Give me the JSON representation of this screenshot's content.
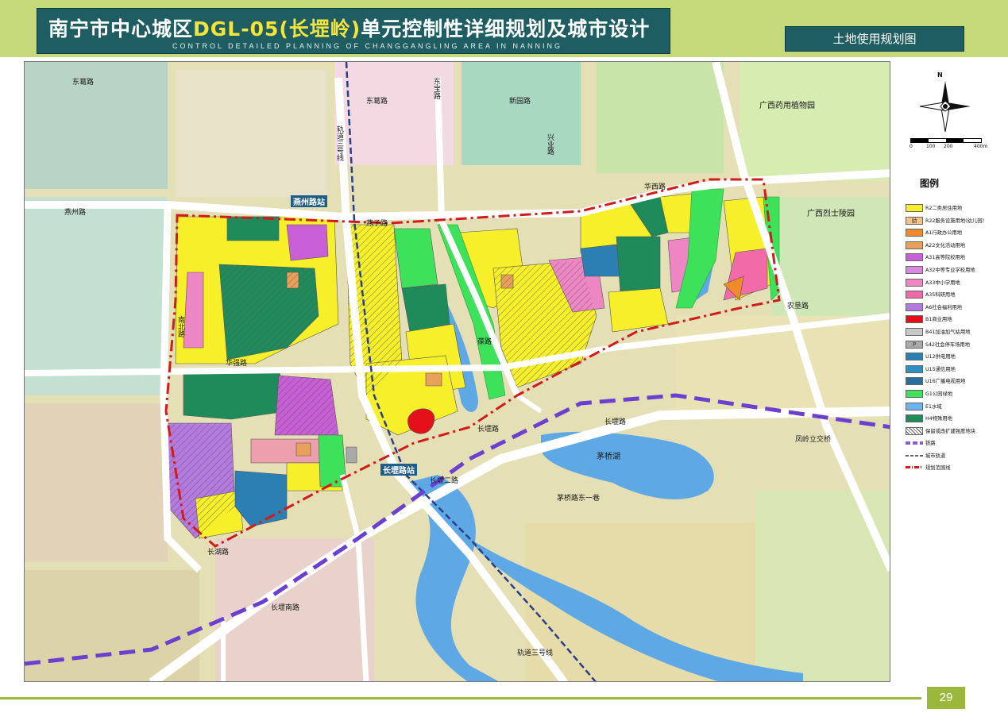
{
  "header": {
    "title_prefix": "南宁市中心城区",
    "title_code": "DGL-05(长堽岭)",
    "title_suffix": "单元控制性详细规划及城市设计",
    "subtitle": "CONTROL DETAILED PLANNING OF CHANGGANGLING AREA IN NANNING",
    "sheet_title": "土地使用规划图"
  },
  "map": {
    "labels": {
      "dongge_rd_1": "东葛路",
      "dongge_rd_2": "东葛路",
      "yanzi_rd": "燕子路",
      "huaxi_rd": "华西路",
      "xinyuan_rd": "新园路",
      "dongbao_rd": "东宝路",
      "xingye_rd": "兴业路",
      "bao_rd": "葆路",
      "ginjiang_rd": "华强路",
      "gangbei_rd": "南北路",
      "yanzhou_rd": "燕州路",
      "changgang_rd": "长堽路",
      "changgang_rd2": "长堽路",
      "rail_line_3": "轨道三号线",
      "rail_line_3b": "轨道三号线",
      "bottom_rd": "长堽二路",
      "bottom_rd2": "长堽南路",
      "changqiao_rd": "长湖路",
      "herb_garden": "广西药用植物园",
      "martyrs_cemetery": "广西烈士陵园",
      "maoqiao_lake": "茅桥湖",
      "maoqiao_rd": "茅桥路东一巷",
      "lingjiang": "凤岭立交桥",
      "nongken_rd": "农垦路",
      "yanzhou_station": "燕州路站",
      "changgang_station": "长堽路站"
    }
  },
  "legend": {
    "north": "N",
    "scale": [
      "0",
      "100",
      "200",
      "400m"
    ],
    "title": "图例",
    "items": [
      {
        "code": "R2",
        "label": "R2二类居住用地",
        "color": "#f7ef2a",
        "mark": ""
      },
      {
        "code": "R22",
        "label": "R22服务设施用地(幼儿园)",
        "color": "#f4c28a",
        "mark": "幼"
      },
      {
        "code": "A1",
        "label": "A1行政办公用地",
        "color": "#f08a2a",
        "mark": ""
      },
      {
        "code": "A22",
        "label": "A22文化活动用地",
        "color": "#e8a05a",
        "mark": ""
      },
      {
        "code": "A31",
        "label": "A31高等院校用地",
        "color": "#c95fd6",
        "mark": ""
      },
      {
        "code": "A32",
        "label": "A32中等专业学校用地",
        "color": "#d98ae0",
        "mark": ""
      },
      {
        "code": "A33",
        "label": "A33中小学用地",
        "color": "#ee86c4",
        "mark": ""
      },
      {
        "code": "A35",
        "label": "A35科研用地",
        "color": "#f26aa8",
        "mark": ""
      },
      {
        "code": "A6",
        "label": "A6社会福利用地",
        "color": "#b57ae0",
        "mark": ""
      },
      {
        "code": "B1",
        "label": "B1商业用地",
        "color": "#e3101a",
        "mark": ""
      },
      {
        "code": "B41",
        "label": "B41加油加气站用地",
        "color": "#c9c9c9",
        "mark": ""
      },
      {
        "code": "S42",
        "label": "S42社会停车场用地",
        "color": "#a9a9a9",
        "mark": "P"
      },
      {
        "code": "U12",
        "label": "U12供电用地",
        "color": "#2b7fb3",
        "mark": ""
      },
      {
        "code": "U15",
        "label": "U15通信用地",
        "color": "#2e8fc2",
        "mark": ""
      },
      {
        "code": "U16",
        "label": "U16广播电视用地",
        "color": "#2a6fa0",
        "mark": ""
      },
      {
        "code": "G1",
        "label": "G1公园绿地",
        "color": "#3ee25a",
        "mark": ""
      },
      {
        "code": "E1",
        "label": "E1水域",
        "color": "#6fb4ef",
        "mark": ""
      },
      {
        "code": "H4",
        "label": "H4特殊用地",
        "color": "#1f8a5a",
        "mark": ""
      },
      {
        "code": "HATCH",
        "label": "保留或改扩建强度地块",
        "color": "#c8c8c8",
        "mark": ""
      },
      {
        "code": "RAIL",
        "label": "铁路",
        "color": "#8a5bd6",
        "mark": ""
      },
      {
        "code": "METRO",
        "label": "城市轨道",
        "color": "#666666",
        "mark": ""
      },
      {
        "code": "BOUND",
        "label": "规划范围线",
        "color": "#d11a1a",
        "mark": ""
      }
    ]
  },
  "footer": {
    "page_number": "29"
  }
}
